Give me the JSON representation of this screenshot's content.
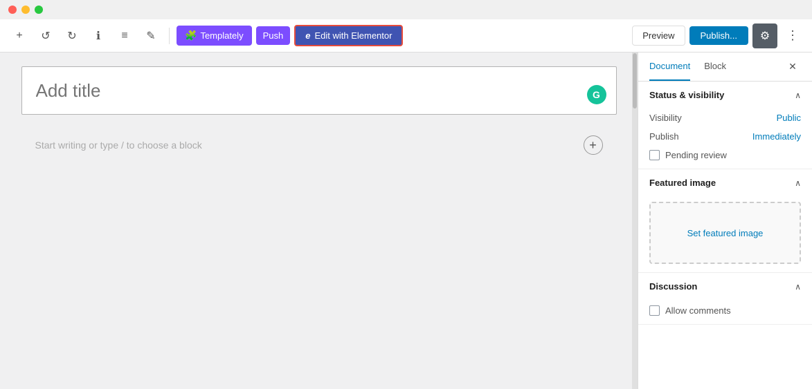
{
  "titleBar": {
    "lights": [
      "red",
      "yellow",
      "green"
    ]
  },
  "toolbar": {
    "addLabel": "+",
    "undoLabel": "↺",
    "redoLabel": "↻",
    "infoLabel": "ℹ",
    "listLabel": "≡",
    "penLabel": "✎",
    "templatelyLabel": "Templately",
    "pushLabel": "Push",
    "elementorLabel": "Edit with Elementor",
    "previewLabel": "Preview",
    "publishLabel": "Publish...",
    "settingsLabel": "⚙",
    "moreLabel": "⋮"
  },
  "editor": {
    "titlePlaceholder": "Add title",
    "writePlaceholder": "Start writing or type / to choose a block",
    "grammarlyLetter": "G"
  },
  "sidebar": {
    "documentTab": "Document",
    "blockTab": "Block",
    "closeLabel": "✕",
    "sections": [
      {
        "id": "status-visibility",
        "title": "Status & visibility",
        "rows": [
          {
            "label": "Visibility",
            "value": "Public"
          },
          {
            "label": "Publish",
            "value": "Immediately"
          }
        ],
        "pending": {
          "label": "Pending review"
        }
      },
      {
        "id": "featured-image",
        "title": "Featured image",
        "setLabel": "Set featured image"
      },
      {
        "id": "discussion",
        "title": "Discussion",
        "allowComments": "Allow comments"
      }
    ]
  }
}
